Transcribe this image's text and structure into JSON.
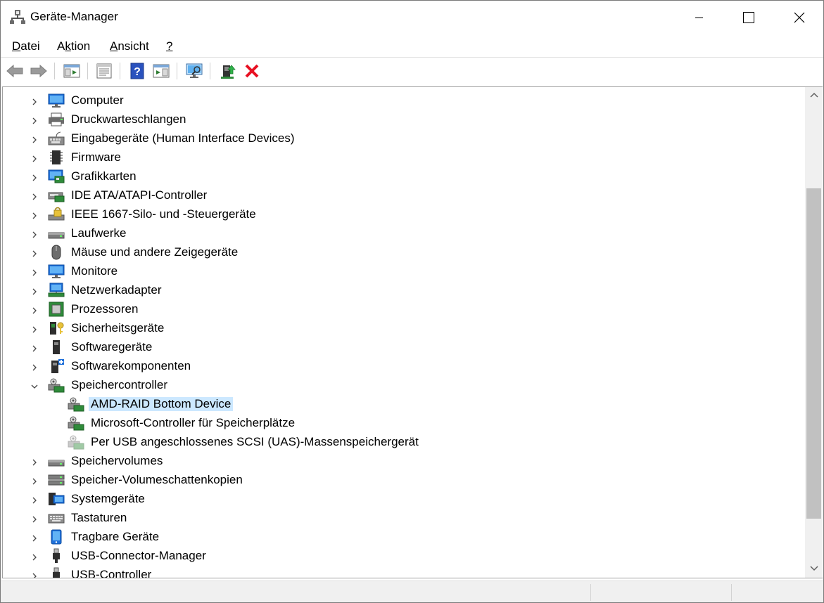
{
  "window": {
    "title": "Geräte-Manager",
    "icon": "device-manager-icon"
  },
  "menu": [
    {
      "label": "Datei",
      "mnemonic_index": 0
    },
    {
      "label": "Aktion",
      "mnemonic_index": 1
    },
    {
      "label": "Ansicht",
      "mnemonic_index": 0
    },
    {
      "label": "?",
      "mnemonic_index": 0
    }
  ],
  "toolbar": [
    {
      "name": "back-button",
      "icon": "arrow-left-icon",
      "enabled": false
    },
    {
      "name": "forward-button",
      "icon": "arrow-right-icon",
      "enabled": false
    },
    {
      "name": "show-hide-console-tree-button",
      "icon": "console-tree-icon"
    },
    {
      "name": "properties-button",
      "icon": "properties-icon"
    },
    {
      "name": "help-button",
      "icon": "help-icon"
    },
    {
      "name": "action-pane-button",
      "icon": "action-pane-icon"
    },
    {
      "name": "scan-hardware-button",
      "icon": "scan-monitor-icon"
    },
    {
      "name": "update-driver-button",
      "icon": "update-driver-icon"
    },
    {
      "name": "uninstall-device-button",
      "icon": "red-x-icon"
    }
  ],
  "tree": [
    {
      "label": "Computer",
      "icon": "computer-icon",
      "level": 0,
      "expanded": false
    },
    {
      "label": "Druckwarteschlangen",
      "icon": "printer-icon",
      "level": 0,
      "expanded": false
    },
    {
      "label": "Eingabegeräte (Human Interface Devices)",
      "icon": "hid-icon",
      "level": 0,
      "expanded": false
    },
    {
      "label": "Firmware",
      "icon": "firmware-icon",
      "level": 0,
      "expanded": false
    },
    {
      "label": "Grafikkarten",
      "icon": "display-adapter-icon",
      "level": 0,
      "expanded": false
    },
    {
      "label": "IDE ATA/ATAPI-Controller",
      "icon": "ide-controller-icon",
      "level": 0,
      "expanded": false
    },
    {
      "label": "IEEE 1667-Silo- und -Steuergeräte",
      "icon": "ieee-lock-icon",
      "level": 0,
      "expanded": false
    },
    {
      "label": "Laufwerke",
      "icon": "disk-drive-icon",
      "level": 0,
      "expanded": false
    },
    {
      "label": "Mäuse und andere Zeigegeräte",
      "icon": "mouse-icon",
      "level": 0,
      "expanded": false
    },
    {
      "label": "Monitore",
      "icon": "monitor-icon",
      "level": 0,
      "expanded": false
    },
    {
      "label": "Netzwerkadapter",
      "icon": "network-adapter-icon",
      "level": 0,
      "expanded": false
    },
    {
      "label": "Prozessoren",
      "icon": "processor-icon",
      "level": 0,
      "expanded": false
    },
    {
      "label": "Sicherheitsgeräte",
      "icon": "security-key-icon",
      "level": 0,
      "expanded": false
    },
    {
      "label": "Softwaregeräte",
      "icon": "software-device-icon",
      "level": 0,
      "expanded": false
    },
    {
      "label": "Softwarekomponenten",
      "icon": "software-component-icon",
      "level": 0,
      "expanded": false
    },
    {
      "label": "Speichercontroller",
      "icon": "storage-controller-icon",
      "level": 0,
      "expanded": true
    },
    {
      "label": "AMD-RAID Bottom Device",
      "icon": "storage-controller-icon",
      "level": 1,
      "selected": true
    },
    {
      "label": "Microsoft-Controller für Speicherplätze",
      "icon": "storage-controller-icon",
      "level": 1
    },
    {
      "label": "Per USB angeschlossenes SCSI (UAS)-Massenspeichergerät",
      "icon": "storage-controller-faded-icon",
      "level": 1
    },
    {
      "label": "Speichervolumes",
      "icon": "disk-drive-icon",
      "level": 0,
      "expanded": false
    },
    {
      "label": "Speicher-Volumeschattenkopien",
      "icon": "shadow-copy-icon",
      "level": 0,
      "expanded": false
    },
    {
      "label": "Systemgeräte",
      "icon": "system-device-icon",
      "level": 0,
      "expanded": false
    },
    {
      "label": "Tastaturen",
      "icon": "keyboard-icon",
      "level": 0,
      "expanded": false
    },
    {
      "label": "Tragbare Geräte",
      "icon": "portable-device-icon",
      "level": 0,
      "expanded": false
    },
    {
      "label": "USB-Connector-Manager",
      "icon": "usb-icon",
      "level": 0,
      "expanded": false
    },
    {
      "label": "USB-Controller",
      "icon": "usb-icon",
      "level": 0,
      "expanded": false
    }
  ],
  "colors": {
    "selection": "#cce8ff",
    "accent_blue": "#0078d7",
    "red_x": "#e81123"
  }
}
